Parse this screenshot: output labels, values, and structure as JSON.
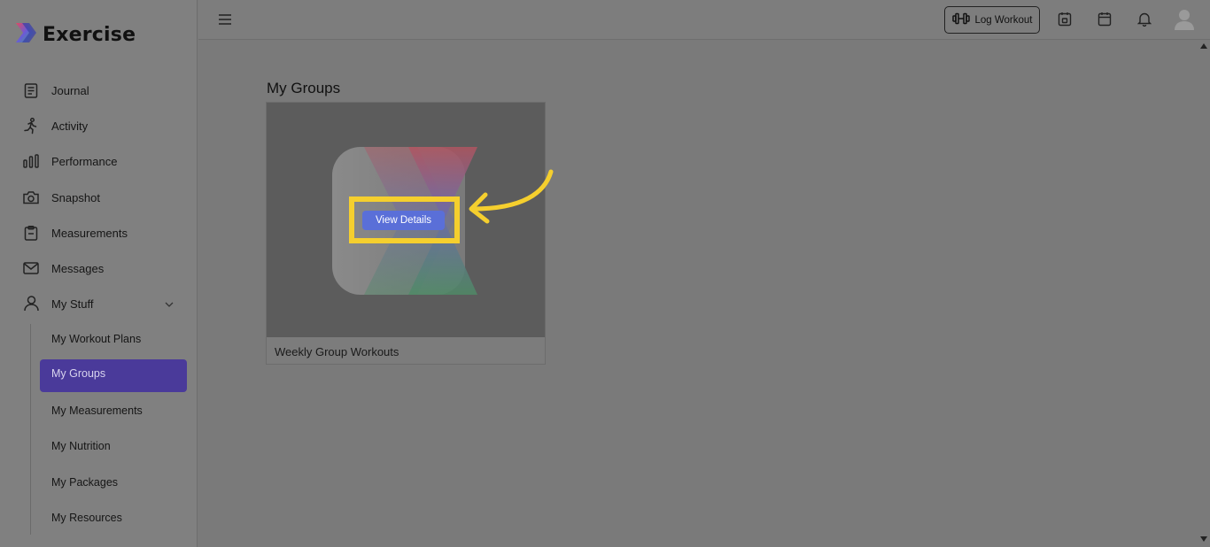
{
  "brand": {
    "name": "Exercise"
  },
  "sidebar": {
    "items": [
      {
        "label": "Journal",
        "icon": "journal-icon"
      },
      {
        "label": "Activity",
        "icon": "running-icon"
      },
      {
        "label": "Performance",
        "icon": "bar-chart-icon"
      },
      {
        "label": "Snapshot",
        "icon": "camera-icon"
      },
      {
        "label": "Measurements",
        "icon": "clipboard-icon"
      },
      {
        "label": "Messages",
        "icon": "mail-icon"
      },
      {
        "label": "My Stuff",
        "icon": "user-icon"
      }
    ],
    "my_stuff_children": [
      {
        "label": "My Workout Plans"
      },
      {
        "label": "My Groups",
        "active": true
      },
      {
        "label": "My Measurements"
      },
      {
        "label": "My Nutrition"
      },
      {
        "label": "My Packages"
      },
      {
        "label": "My Resources"
      }
    ]
  },
  "topbar": {
    "log_workout_label": "Log Workout",
    "icons": [
      "menu-icon",
      "dumbbell-icon",
      "calendar-day-icon",
      "calendar-icon",
      "bell-icon",
      "avatar-icon"
    ]
  },
  "main": {
    "title": "My Groups",
    "cards": [
      {
        "name": "Weekly Group Workouts",
        "button_label": "View Details"
      }
    ]
  },
  "colors": {
    "accent": "#4a3a9a",
    "button": "#5a6fd8",
    "highlight": "#f5cf2e"
  }
}
